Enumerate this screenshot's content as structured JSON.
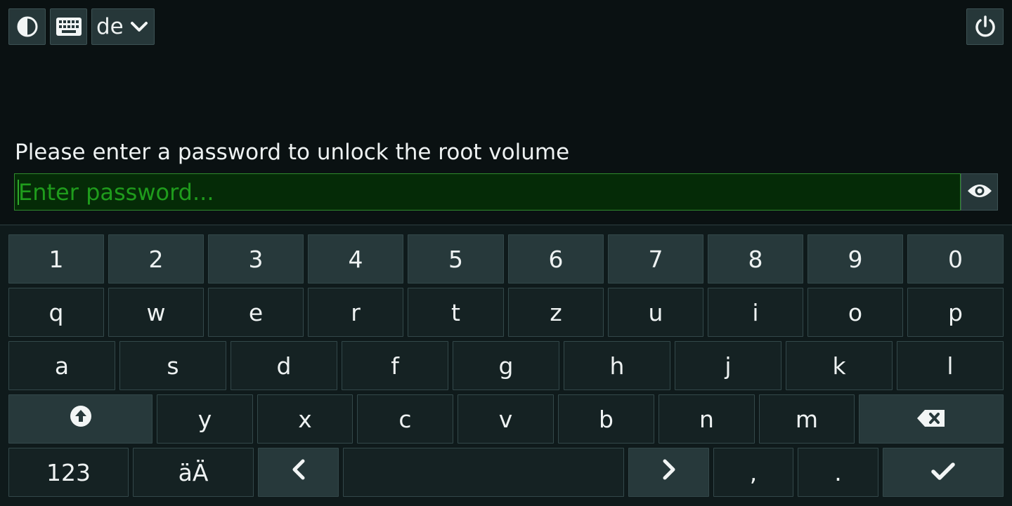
{
  "toolbar": {
    "contrast_icon": "contrast-icon",
    "keyboard_icon": "keyboard-icon",
    "language": "de",
    "language_icon": "chevron-down-icon",
    "power_icon": "power-icon"
  },
  "prompt": "Please enter a password to unlock the root volume",
  "password": {
    "value": "",
    "placeholder": "Enter password...",
    "toggle_icon": "eye-icon"
  },
  "keyboard": {
    "row1": [
      "1",
      "2",
      "3",
      "4",
      "5",
      "6",
      "7",
      "8",
      "9",
      "0"
    ],
    "row2": [
      "q",
      "w",
      "e",
      "r",
      "t",
      "z",
      "u",
      "i",
      "o",
      "p"
    ],
    "row3": [
      "a",
      "s",
      "d",
      "f",
      "g",
      "h",
      "j",
      "k",
      "l"
    ],
    "row4": [
      "y",
      "x",
      "c",
      "v",
      "b",
      "n",
      "m"
    ],
    "row4_icons": {
      "shift": "shift-arrow-up-icon",
      "backspace": "backspace-icon"
    },
    "row5": {
      "numeric": "123",
      "umlaut": "äÄ",
      "comma": ",",
      "period": ".",
      "left_icon": "chevron-left-icon",
      "right_icon": "chevron-right-icon",
      "enter_icon": "checkmark-icon"
    }
  },
  "colors": {
    "background": "#0a1112",
    "key_light": "#27393b",
    "key_dark": "#152223",
    "field_background": "#052b07",
    "field_accent": "#2fa82a"
  }
}
